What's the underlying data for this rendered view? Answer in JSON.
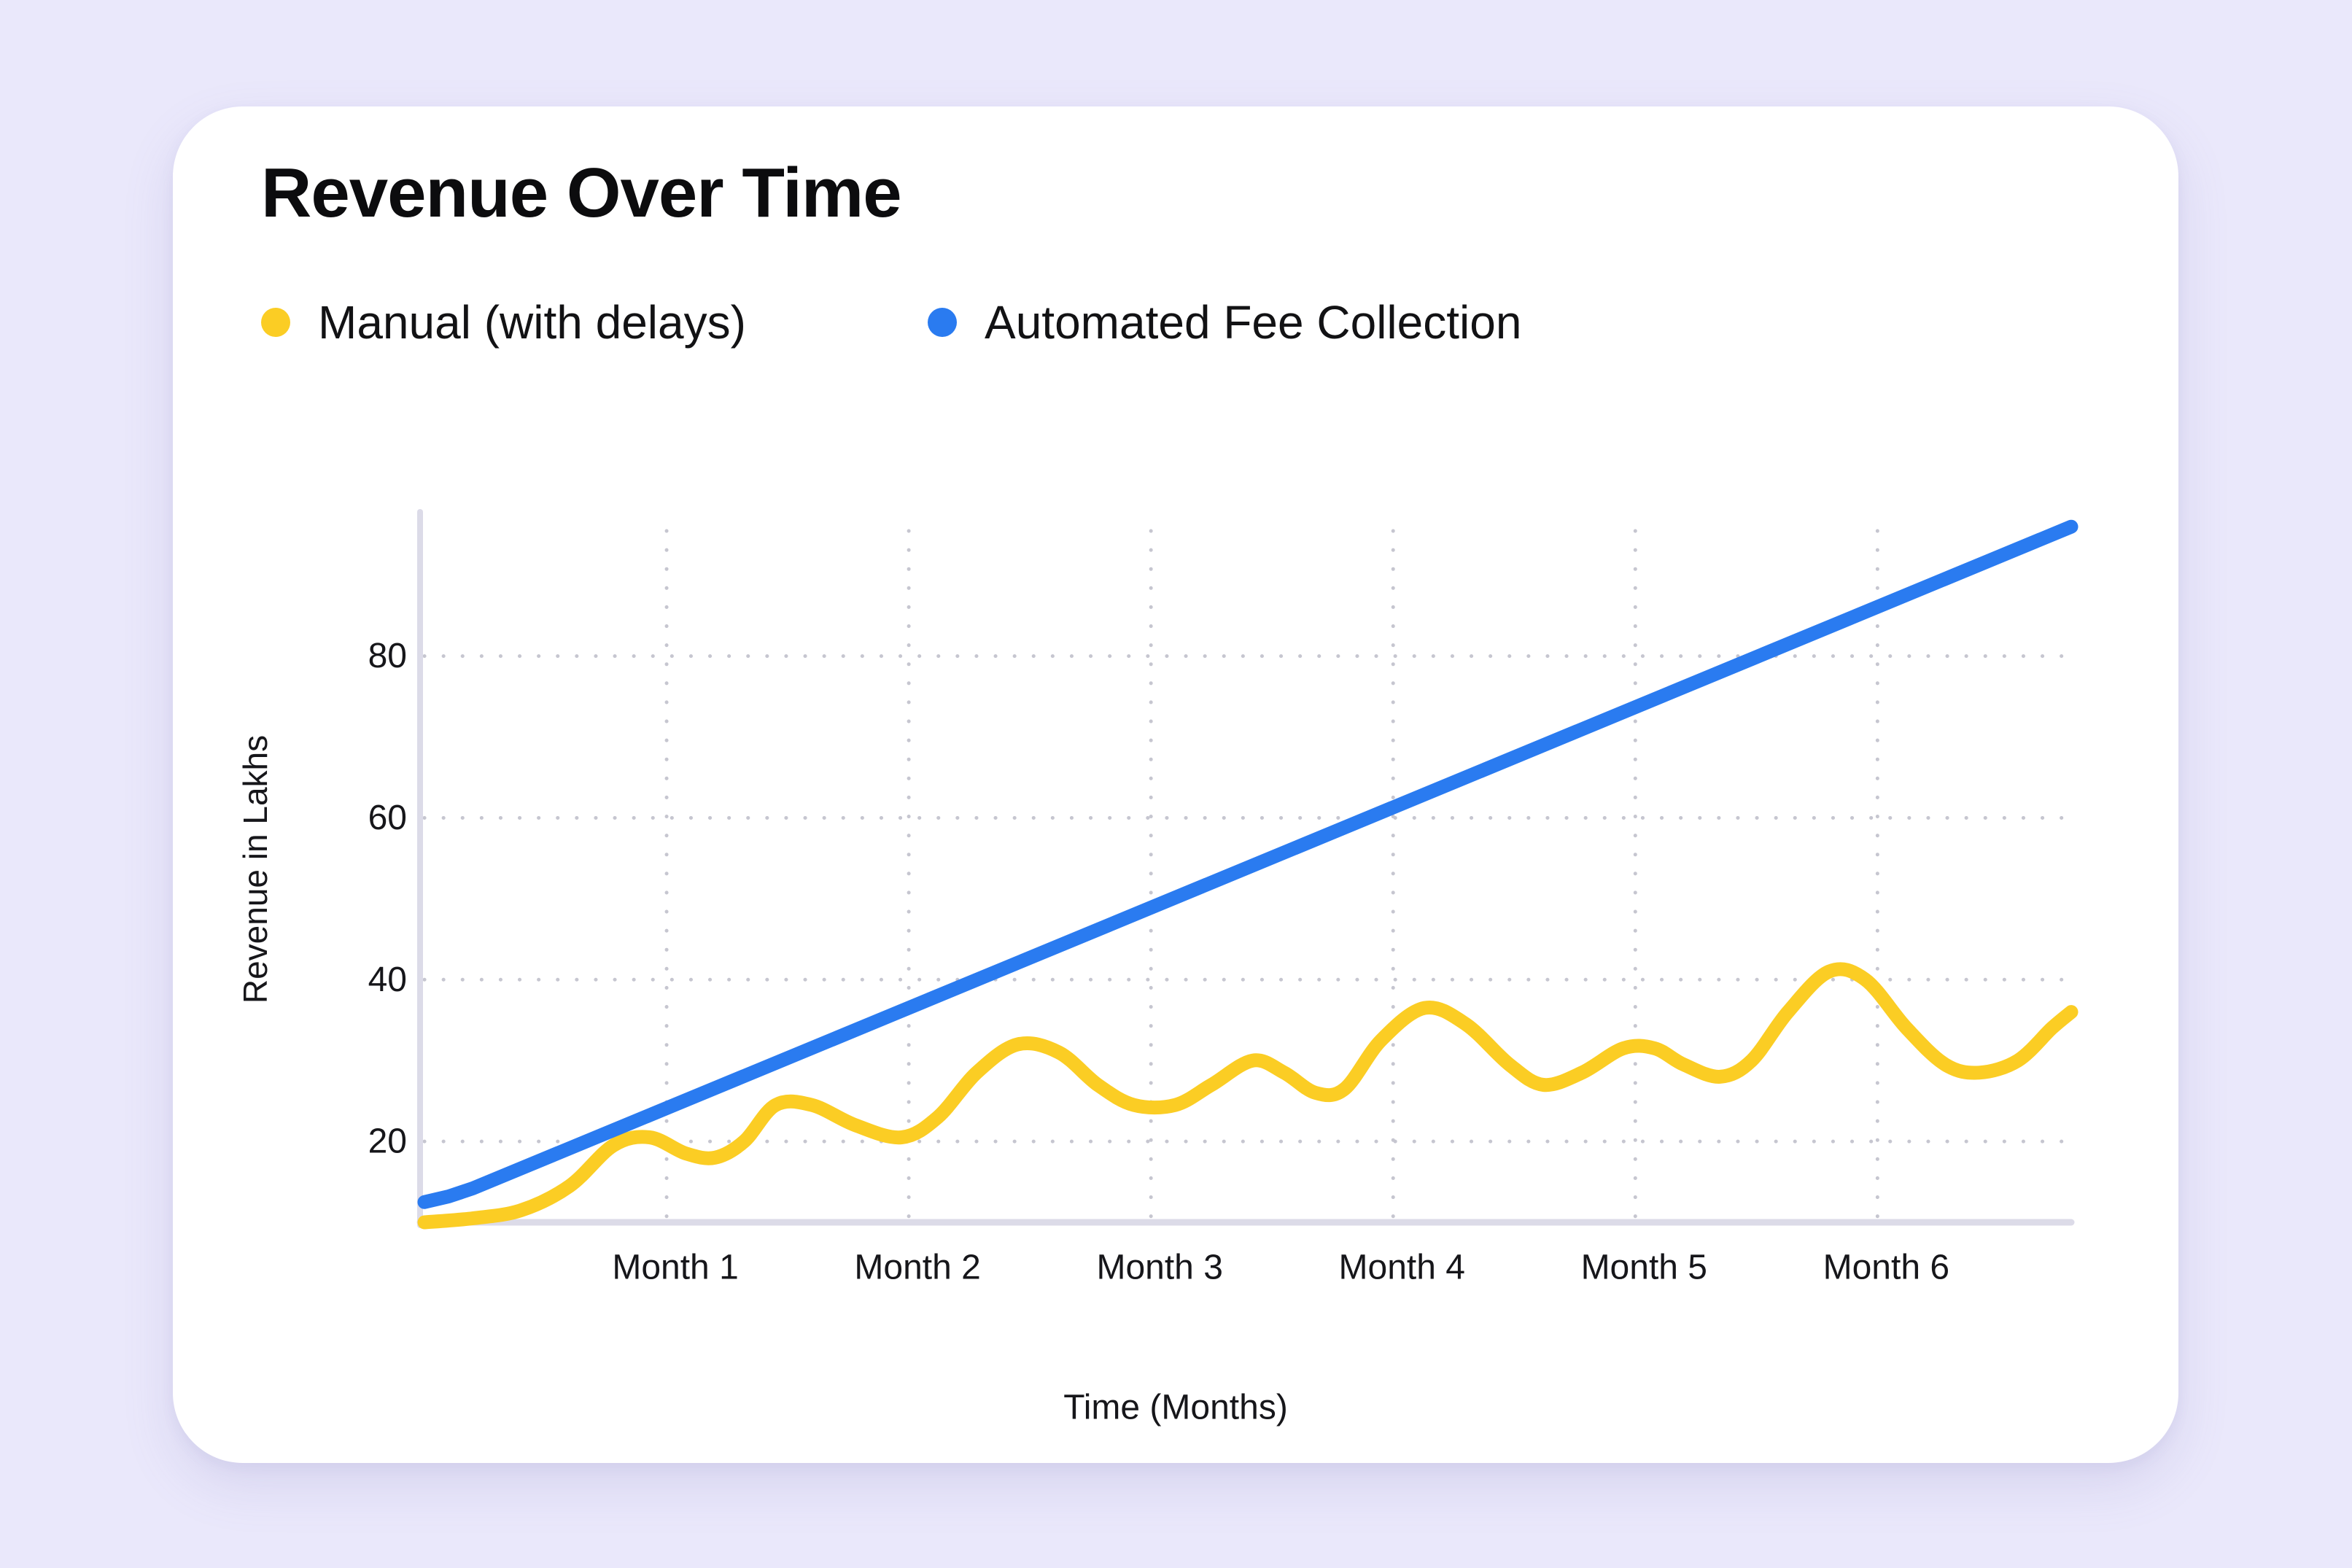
{
  "colors": {
    "page_background": "#eae8fb",
    "card_background": "#ffffff",
    "manual_series": "#fbcd24",
    "automated_series": "#2a7bf0",
    "axis": "#dcdbe8",
    "grid": "#c6c6d0"
  },
  "chart_data": {
    "type": "line",
    "title": "Revenue Over Time",
    "xlabel": "Time (Months)",
    "ylabel": "Revenue in Lakhs",
    "categories": [
      "Month 1",
      "Month 2",
      "Month 3",
      "Month 4",
      "Month 5",
      "Month 6"
    ],
    "xlim": [
      0,
      6.8
    ],
    "ylim": [
      10,
      98
    ],
    "y_ticks": [
      20,
      40,
      60,
      80
    ],
    "x_ticks": [
      1,
      2,
      3,
      4,
      5,
      6
    ],
    "grid": true,
    "grid_style": "dotted",
    "legend_position": "top-left",
    "series": [
      {
        "name": "Manual (with delays)",
        "color": "#fbcd24",
        "points": [
          [
            0,
            10
          ],
          [
            0.2,
            10.5
          ],
          [
            0.4,
            11.5
          ],
          [
            0.6,
            14.5
          ],
          [
            0.78,
            19.5
          ],
          [
            0.93,
            20.5
          ],
          [
            1.08,
            18.5
          ],
          [
            1.2,
            18
          ],
          [
            1.32,
            20
          ],
          [
            1.45,
            24.5
          ],
          [
            1.6,
            24.5
          ],
          [
            1.78,
            22
          ],
          [
            1.97,
            20.5
          ],
          [
            2.12,
            23
          ],
          [
            2.28,
            28.5
          ],
          [
            2.45,
            32
          ],
          [
            2.62,
            31
          ],
          [
            2.78,
            27
          ],
          [
            2.93,
            24.5
          ],
          [
            3.1,
            24.5
          ],
          [
            3.25,
            27
          ],
          [
            3.42,
            30
          ],
          [
            3.55,
            28.5
          ],
          [
            3.68,
            26
          ],
          [
            3.8,
            26.5
          ],
          [
            3.95,
            32.5
          ],
          [
            4.13,
            36.5
          ],
          [
            4.3,
            34.5
          ],
          [
            4.48,
            29.5
          ],
          [
            4.62,
            27
          ],
          [
            4.78,
            28.5
          ],
          [
            4.95,
            31.5
          ],
          [
            5.08,
            31.5
          ],
          [
            5.2,
            29.5
          ],
          [
            5.35,
            28
          ],
          [
            5.48,
            30
          ],
          [
            5.63,
            36
          ],
          [
            5.8,
            41
          ],
          [
            5.95,
            40
          ],
          [
            6.12,
            34
          ],
          [
            6.28,
            29.5
          ],
          [
            6.42,
            28.5
          ],
          [
            6.58,
            30
          ],
          [
            6.72,
            34
          ],
          [
            6.8,
            36
          ]
        ]
      },
      {
        "name": "Automated Fee Collection",
        "color": "#2a7bf0",
        "points": [
          [
            0,
            12.5
          ],
          [
            0.1,
            13.2
          ],
          [
            0.2,
            14.2
          ],
          [
            6.8,
            96
          ]
        ]
      }
    ]
  }
}
